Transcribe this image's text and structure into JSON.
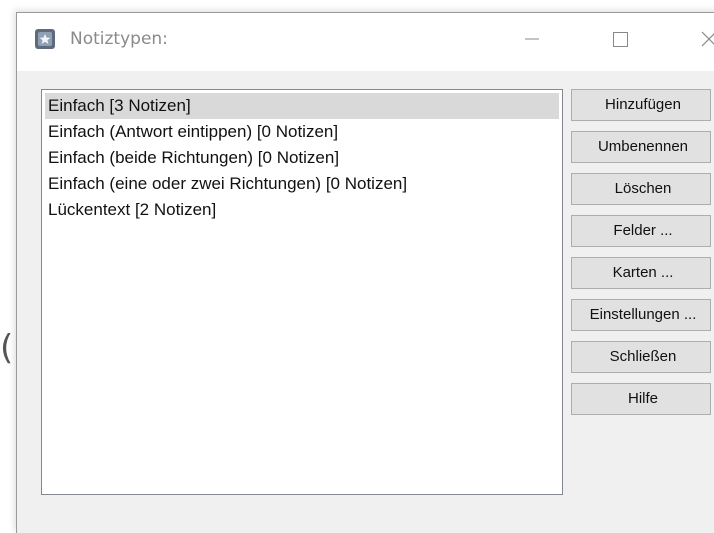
{
  "window": {
    "title": "Notiztypen:",
    "controls": {
      "minimize_icon": "minimize-icon",
      "maximize_icon": "maximize-icon",
      "close_icon": "close-icon"
    }
  },
  "note_types": [
    {
      "label": "Einfach [3 Notizen]",
      "selected": true
    },
    {
      "label": "Einfach (Antwort eintippen) [0 Notizen]",
      "selected": false
    },
    {
      "label": "Einfach (beide Richtungen) [0 Notizen]",
      "selected": false
    },
    {
      "label": "Einfach (eine oder zwei Richtungen) [0 Notizen]",
      "selected": false
    },
    {
      "label": "Lückentext [2 Notizen]",
      "selected": false
    }
  ],
  "buttons": {
    "add": "Hinzufügen",
    "rename": "Umbenennen",
    "delete": "Löschen",
    "fields": "Felder ...",
    "cards": "Karten ...",
    "options": "Einstellungen ...",
    "close": "Schließen",
    "help": "Hilfe"
  },
  "colors": {
    "selection": "#d9d9d9",
    "button_face": "#e1e1e1",
    "dialog_background": "#f0f0f0",
    "title_text": "#8a8a8a"
  }
}
